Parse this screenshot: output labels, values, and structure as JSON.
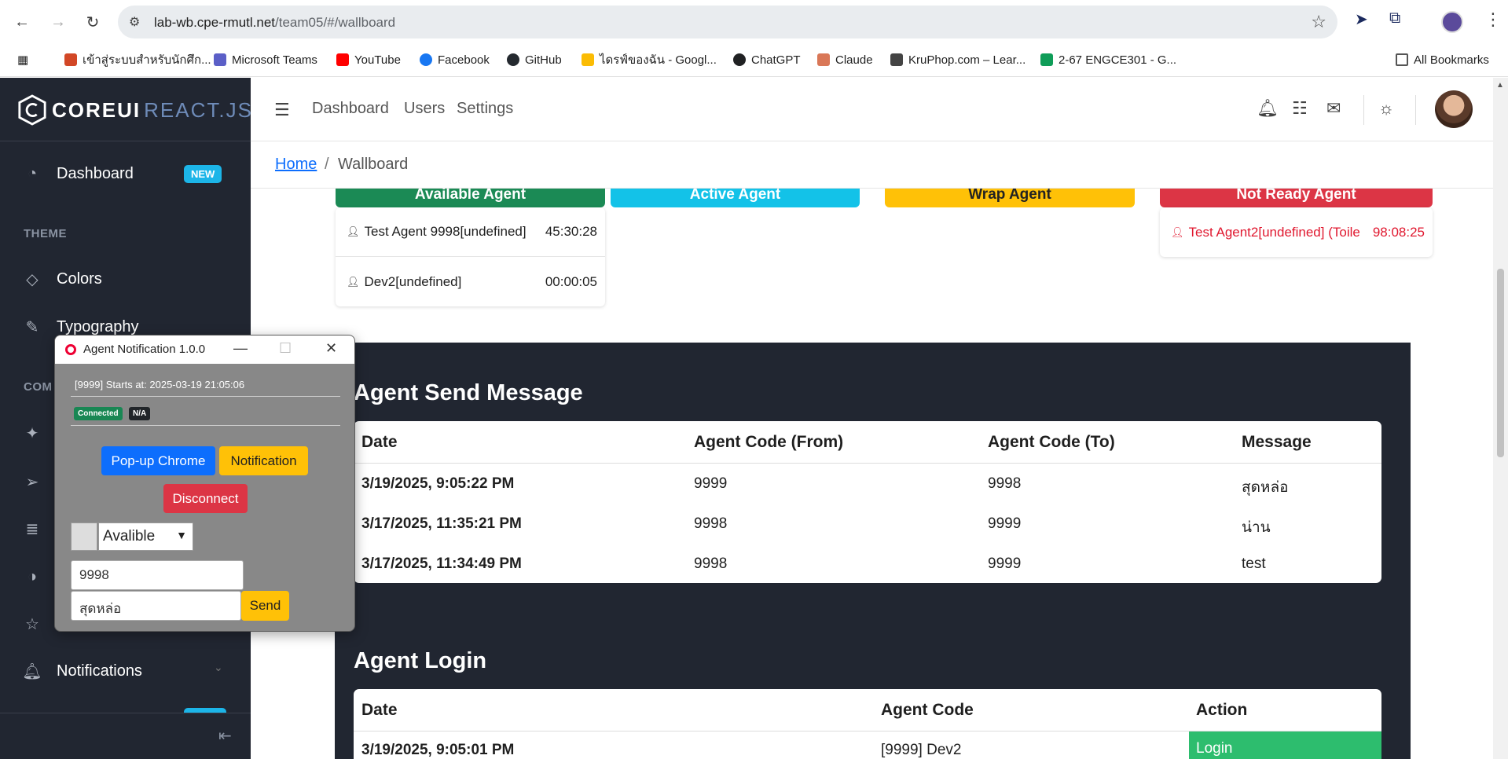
{
  "browser": {
    "url_host": "lab-wb.cpe-rmutl.net",
    "url_path": "/team05/#/wallboard",
    "bookmarks": [
      {
        "label": "เข้าสู่ระบบสำหรับนักศึก...",
        "color": "#d24726"
      },
      {
        "label": "Microsoft Teams",
        "color": "#5b5fc7"
      },
      {
        "label": "YouTube",
        "color": "#ff0000"
      },
      {
        "label": "Facebook",
        "color": "#1877f2"
      },
      {
        "label": "GitHub",
        "color": "#24292f"
      },
      {
        "label": "ไดรฟ์ของฉัน - Googl...",
        "color": "#fbbc04"
      },
      {
        "label": "ChatGPT",
        "color": "#202123"
      },
      {
        "label": "Claude",
        "color": "#d97757"
      },
      {
        "label": "KruPhop.com – Lear...",
        "color": "#444444"
      },
      {
        "label": "2-67 ENGCE301 - G...",
        "color": "#0f9d58"
      }
    ],
    "all_bookmarks": "All Bookmarks"
  },
  "sidebar": {
    "brand": "COREUI",
    "brand_suffix": "REACT.JS",
    "dashboard": "Dashboard",
    "badge": "NEW",
    "theme_title": "THEME",
    "colors": "Colors",
    "typography": "Typography",
    "components_title": "COM",
    "notifications": "Notifications"
  },
  "header": {
    "nav": [
      "Dashboard",
      "Users",
      "Settings"
    ]
  },
  "breadcrumb": {
    "home": "Home",
    "sep": "/",
    "current": "Wallboard"
  },
  "status": {
    "available": {
      "label": "Available Agent",
      "color": "#1b8a55"
    },
    "active": {
      "label": "Active Agent",
      "color": "#13c2e8"
    },
    "wrap": {
      "label": "Wrap Agent",
      "color": "#ffc107"
    },
    "notready": {
      "label": "Not Ready Agent",
      "color": "#dc3545"
    }
  },
  "available_agents": [
    {
      "name": "Test Agent 9998[undefined]",
      "time": "45:30:28"
    },
    {
      "name": "Dev2[undefined]",
      "time": "00:00:05"
    }
  ],
  "notready_agents": [
    {
      "name": "Test Agent2[undefined] (Toile",
      "time": "98:08:25"
    }
  ],
  "messages": {
    "title": "Agent Send Message",
    "headers": [
      "Date",
      "Agent Code (From)",
      "Agent Code (To)",
      "Message"
    ],
    "rows": [
      [
        "3/19/2025, 9:05:22 PM",
        "9999",
        "9998",
        "สุดหล่อ"
      ],
      [
        "3/17/2025, 11:35:21 PM",
        "9998",
        "9999",
        "น่าน"
      ],
      [
        "3/17/2025, 11:34:49 PM",
        "9998",
        "9999",
        "test"
      ]
    ]
  },
  "login": {
    "title": "Agent Login",
    "headers": [
      "Date",
      "Agent Code",
      "Action"
    ],
    "rows": [
      [
        "3/19/2025, 9:05:01 PM",
        "[9999] Dev2",
        "Login"
      ]
    ]
  },
  "popup": {
    "title": "Agent Notification 1.0.0",
    "start": "[9999] Starts at: 2025-03-19 21:05:06",
    "connected": "Connected",
    "na": "N/A",
    "popup_chrome": "Pop-up Chrome",
    "notification": "Notification",
    "disconnect": "Disconnect",
    "status_value": "Avalible",
    "to_value": "9998",
    "message_value": "สุดหล่อ",
    "send": "Send"
  }
}
